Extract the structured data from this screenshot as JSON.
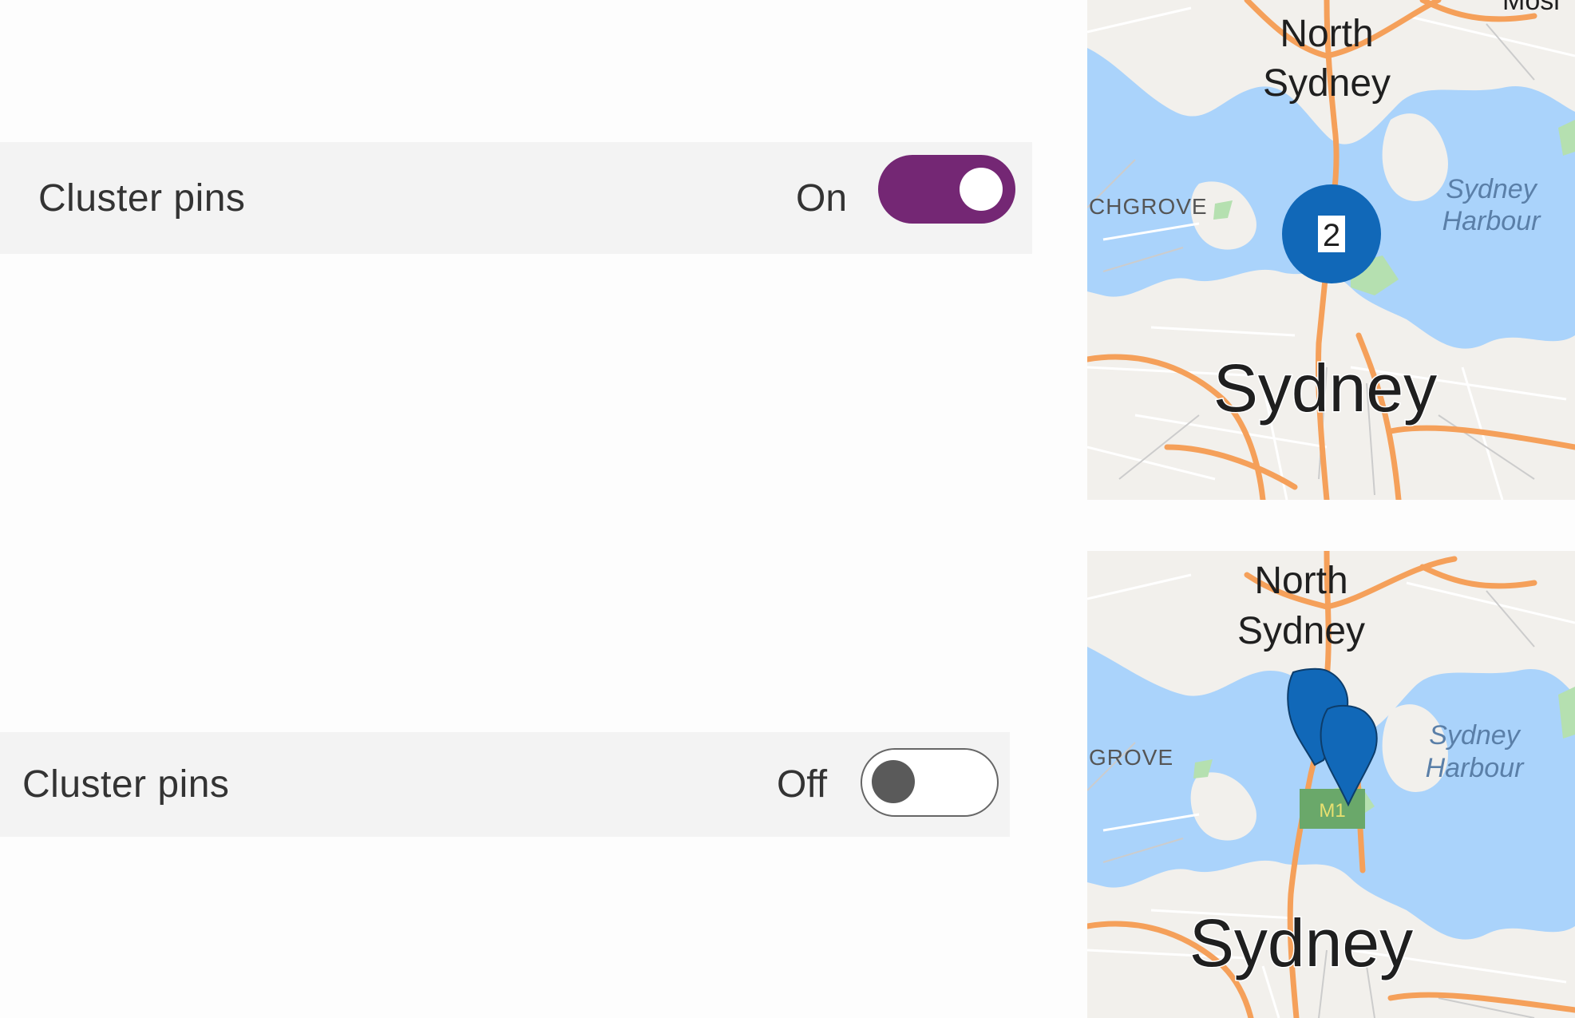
{
  "settings": {
    "on_row": {
      "label": "Cluster pins",
      "state_label": "On",
      "toggle_on": true
    },
    "off_row": {
      "label": "Cluster pins",
      "state_label": "Off",
      "toggle_on": false
    }
  },
  "colors": {
    "toggle_on": "#742774",
    "row_background": "#f3f3f3",
    "pin": "#1168b8",
    "water": "#aad3fb",
    "road": "#f5a05a"
  },
  "map_clustered": {
    "labels": {
      "north": "North",
      "sydney_suburb": "Sydney",
      "city": "Sydney",
      "harbour_line1": "Sydney",
      "harbour_line2": "Harbour",
      "district": "CHGROVE",
      "top_edge": "Mosi"
    },
    "cluster_count": "2"
  },
  "map_unclustered": {
    "labels": {
      "north": "North",
      "sydney_suburb": "Sydney",
      "city": "Sydney",
      "harbour_line1": "Sydney",
      "harbour_line2": "Harbour",
      "district": "GROVE",
      "road_shield": "M1"
    },
    "pin_count": 2
  }
}
